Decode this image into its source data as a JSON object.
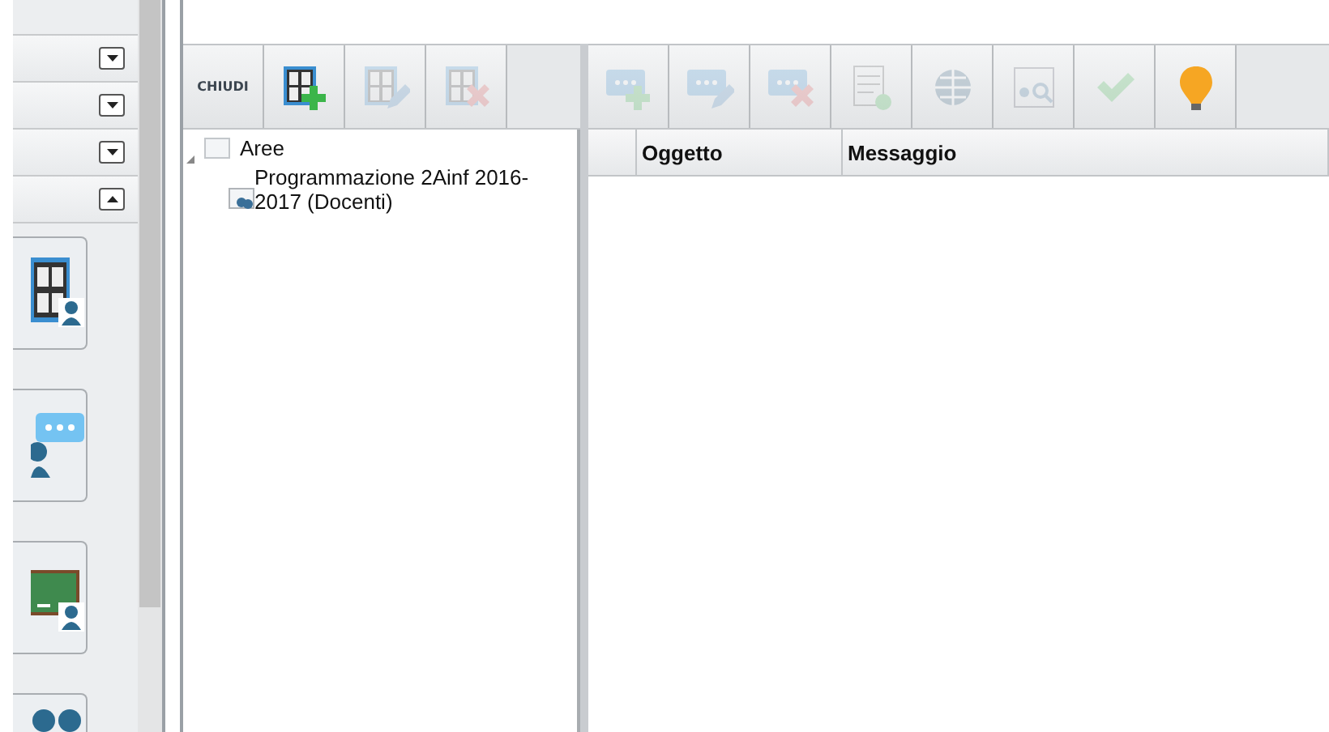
{
  "sidebar": {
    "sections": [
      {
        "expanded": false
      },
      {
        "expanded": false
      },
      {
        "expanded": false
      },
      {
        "expanded": true
      }
    ],
    "tiles": [
      {
        "kind": "board"
      },
      {
        "kind": "chat"
      },
      {
        "kind": "blackboard"
      },
      {
        "kind": "people"
      }
    ]
  },
  "left_toolbar": {
    "buttons": [
      {
        "kind": "text",
        "label": "CHIUDI",
        "disabled": false
      },
      {
        "kind": "grid-add",
        "disabled": false
      },
      {
        "kind": "grid-edit",
        "disabled": true
      },
      {
        "kind": "grid-delete",
        "disabled": true
      }
    ]
  },
  "tree": {
    "items": [
      {
        "label": "Aree",
        "expanded": true,
        "children": [
          {
            "label": "Programmazione 2Ainf 2016-2017 (Docenti)"
          }
        ]
      }
    ]
  },
  "right_toolbar": {
    "buttons": [
      {
        "kind": "chat-add",
        "disabled": true
      },
      {
        "kind": "chat-edit",
        "disabled": true
      },
      {
        "kind": "chat-delete",
        "disabled": true
      },
      {
        "kind": "sheet-add",
        "disabled": true
      },
      {
        "kind": "globe",
        "disabled": true
      },
      {
        "kind": "search",
        "disabled": true
      },
      {
        "kind": "check",
        "disabled": true
      },
      {
        "kind": "bulb",
        "disabled": false
      }
    ]
  },
  "table": {
    "columns": [
      "Oggetto",
      "Messaggio"
    ]
  }
}
